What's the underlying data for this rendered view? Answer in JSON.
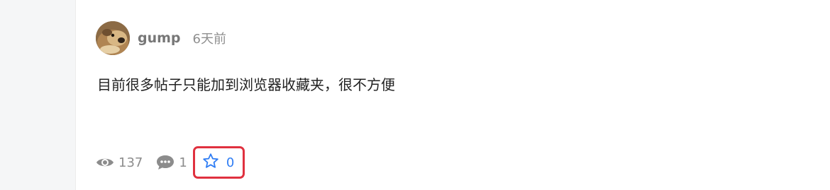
{
  "post": {
    "title": "",
    "author": {
      "name": "gump",
      "time": "6天前"
    },
    "content": "目前很多帖子只能加到浏览器收藏夹，很不方便",
    "stats": {
      "views": "137",
      "comments": "1",
      "favorites": "0"
    }
  },
  "colors": {
    "highlight_border": "#e0313f",
    "favorite_accent": "#2f7df4",
    "muted_text": "#8c8c8c"
  },
  "icons": [
    "eye-icon",
    "comment-icon",
    "star-icon"
  ]
}
